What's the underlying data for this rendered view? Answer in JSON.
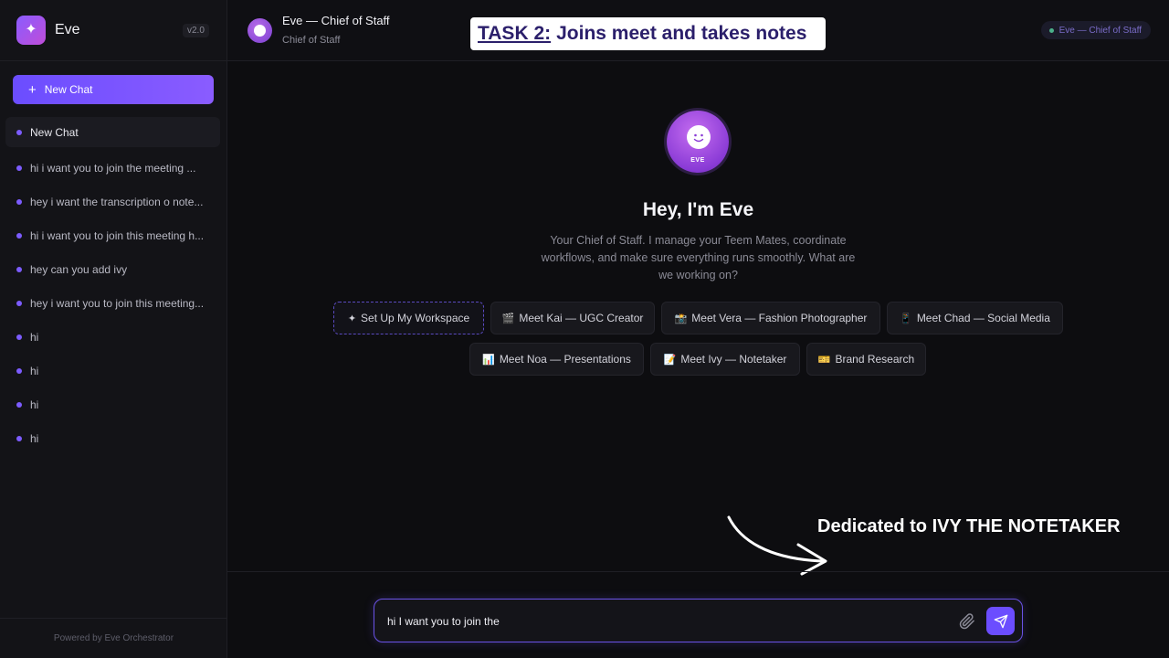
{
  "sidebar": {
    "brand_name": "Eve",
    "version": "v2.0",
    "new_chat_label": "New Chat",
    "chats": [
      {
        "label": "New Chat"
      },
      {
        "label": "hi i want you to join the meeting ..."
      },
      {
        "label": "hey i want the transcription o note..."
      },
      {
        "label": "hi i want you to join this meeting h..."
      },
      {
        "label": "hey can you add ivy"
      },
      {
        "label": "hey i want you to join this meeting..."
      },
      {
        "label": "hi"
      },
      {
        "label": "hi"
      },
      {
        "label": "hi"
      },
      {
        "label": "hi"
      }
    ],
    "footer": "Powered by Eve Orchestrator"
  },
  "header": {
    "title": "Eve — Chief of Staff",
    "subtitle": "Chief of Staff",
    "badge": "Eve — Chief of Staff",
    "task_label": "TASK 2:",
    "task_text": "Joins meet and takes notes"
  },
  "main": {
    "avatar_label": "EVE",
    "greeting": "Hey, I'm Eve",
    "intro": "Your Chief of Staff. I manage your Teem Mates, coordinate workflows, and make sure everything runs smoothly. What are we working on?",
    "chips": [
      {
        "icon": "✦",
        "label": "Set Up My Workspace"
      },
      {
        "icon": "🎬",
        "label": "Meet Kai — UGC Creator"
      },
      {
        "icon": "📸",
        "label": "Meet Vera — Fashion Photographer"
      },
      {
        "icon": "📱",
        "label": "Meet Chad — Social Media"
      },
      {
        "icon": "📊",
        "label": "Meet Noa — Presentations"
      },
      {
        "icon": "📝",
        "label": "Meet Ivy — Notetaker"
      },
      {
        "icon": "🎫",
        "label": "Brand Research"
      }
    ]
  },
  "annotation": {
    "text": "Dedicated to IVY THE NOTETAKER"
  },
  "composer": {
    "value": "hi I want you to join the"
  },
  "colors": {
    "accent": "#6b4dff",
    "background": "#0d0d10",
    "sidebar": "#131317"
  }
}
